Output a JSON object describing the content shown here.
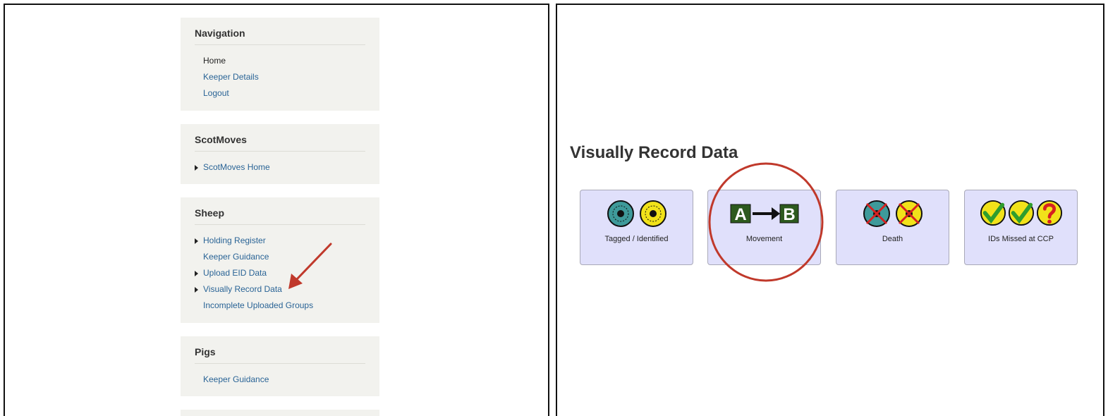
{
  "left": {
    "navigation": {
      "title": "Navigation",
      "items": [
        {
          "label": "Home",
          "style": "plain"
        },
        {
          "label": "Keeper Details",
          "style": "link"
        },
        {
          "label": "Logout",
          "style": "link"
        }
      ]
    },
    "scotmoves": {
      "title": "ScotMoves",
      "items": [
        {
          "label": "ScotMoves Home",
          "style": "link",
          "arrow": true
        }
      ]
    },
    "sheep": {
      "title": "Sheep",
      "items": [
        {
          "label": "Holding Register",
          "arrow": true
        },
        {
          "label": "Keeper Guidance",
          "arrow": false
        },
        {
          "label": "Upload EID Data",
          "arrow": true
        },
        {
          "label": "Visually Record Data",
          "arrow": true
        },
        {
          "label": "Incomplete Uploaded Groups",
          "arrow": false
        }
      ]
    },
    "pigs": {
      "title": "Pigs",
      "items": [
        {
          "label": "Keeper Guidance"
        }
      ]
    }
  },
  "right": {
    "title": "Visually Record Data",
    "tiles": [
      {
        "label": "Tagged / Identified",
        "icon": "tagged-icon"
      },
      {
        "label": "Movement",
        "icon": "a-to-b-movement-icon",
        "letter_a": "A",
        "letter_b": "B"
      },
      {
        "label": "Death",
        "icon": "death-tag-icon"
      },
      {
        "label": "IDs Missed at CCP",
        "icon": "missed-id-icon"
      }
    ]
  },
  "colors": {
    "link": "#2a6496",
    "annotation": "#c0392b",
    "tile_bg": "#e0e0fb",
    "block_bg": "#f2f2ee"
  }
}
